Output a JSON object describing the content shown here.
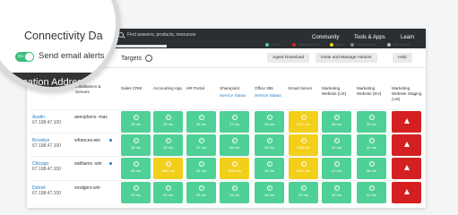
{
  "topbar": {
    "search_placeholder": "Find answers, products, resources",
    "nav": [
      "Community",
      "Tools & Apps",
      "Learn"
    ]
  },
  "toolbar": {
    "targets_label": "Targets",
    "buttons": [
      "Agent Download",
      "Invite and Manage Admins",
      "Help"
    ]
  },
  "legend": [
    {
      "label": "Good",
      "color": "#4fd096"
    },
    {
      "label": "Disconnected",
      "color": "#d42020"
    },
    {
      "label": "Slow",
      "color": "#f2cf1b"
    },
    {
      "label": "Unreachable",
      "color": "#888888"
    },
    {
      "label": "Not Tested",
      "color": "#bbbbbb"
    }
  ],
  "table": {
    "agent_header": "Installations & Servers",
    "columns": [
      {
        "name": "Sales CRM",
        "link": ""
      },
      {
        "name": "Accounting App",
        "link": ""
      },
      {
        "name": "HR Portal",
        "link": ""
      },
      {
        "name": "Sharepoint",
        "link": "Service Status"
      },
      {
        "name": "Office 365",
        "link": "Service Status"
      },
      {
        "name": "Email Server",
        "link": ""
      },
      {
        "name": "Marketing Website (US)",
        "link": ""
      },
      {
        "name": "Marketing Website (EU)",
        "link": ""
      },
      {
        "name": "Marketing Website Staging (US)",
        "link": ""
      }
    ],
    "rows": [
      {
        "city": "Austin",
        "ip": "67.198.47.100",
        "agent": "aeesphens -mac",
        "cells": [
          [
            "good",
            "33 ms"
          ],
          [
            "good",
            "43 ms"
          ],
          [
            "good",
            "38 ms"
          ],
          [
            "good",
            "27 ms"
          ],
          [
            "good",
            "33 ms"
          ],
          [
            "slow",
            "3422 ms"
          ],
          [
            "good",
            "48 ms"
          ],
          [
            "good",
            "49 ms"
          ],
          [
            "down",
            ""
          ]
        ]
      },
      {
        "city": "Brooklyn",
        "ip": "67.198.47.100",
        "agent": "wfrances-win",
        "cells": [
          [
            "good",
            "46 ms"
          ],
          [
            "good",
            "42 ms"
          ],
          [
            "good",
            "31 ms"
          ],
          [
            "good",
            "48 ms"
          ],
          [
            "good",
            "33 ms"
          ],
          [
            "slow",
            "3488 ms"
          ],
          [
            "good",
            "41 ms"
          ],
          [
            "good",
            "44 ms"
          ],
          [
            "down",
            ""
          ]
        ]
      },
      {
        "city": "Chicago",
        "ip": "67.198.47.100",
        "agent": "swilliams -win",
        "cells": [
          [
            "good",
            "46 ms"
          ],
          [
            "slow",
            "3969 ms"
          ],
          [
            "good",
            "34 ms"
          ],
          [
            "slow",
            "3088 ms"
          ],
          [
            "good",
            "44 ms"
          ],
          [
            "slow",
            "3422 ms"
          ],
          [
            "good",
            "41 ms"
          ],
          [
            "good",
            "38 ms"
          ],
          [
            "down",
            ""
          ]
        ]
      },
      {
        "city": "Detroit",
        "ip": "67.198.47.100",
        "agent": "vrodgers-win",
        "cells": [
          [
            "good",
            "33 ms"
          ],
          [
            "good",
            "42 ms"
          ],
          [
            "good",
            "48 ms"
          ],
          [
            "good",
            "33 ms"
          ],
          [
            "good",
            "49 ms"
          ],
          [
            "good",
            "33 ms"
          ],
          [
            "good",
            "40 ms"
          ],
          [
            "good",
            "42 ms"
          ],
          [
            "down",
            ""
          ]
        ]
      }
    ]
  },
  "magnifier": {
    "title": "Connectivity Da",
    "toggle_label": "On",
    "alert_label": "Send email alerts",
    "location_header": "Location Address"
  }
}
